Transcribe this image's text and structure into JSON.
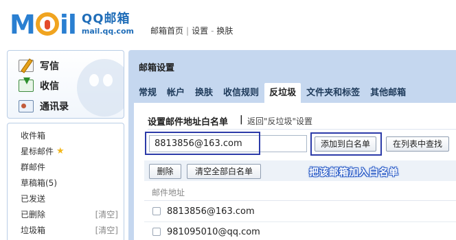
{
  "header": {
    "logo": {
      "letters": [
        "M",
        "il"
      ],
      "brand": "QQ邮箱",
      "url": "mail.qq.com"
    },
    "links": [
      "邮箱首页",
      "设置",
      "换肤"
    ],
    "link_separator": "|",
    "link_dash": "-"
  },
  "sidebar": {
    "actions": [
      {
        "label": "写信",
        "icon": "pencil-icon"
      },
      {
        "label": "收信",
        "icon": "inbox-download-icon"
      },
      {
        "label": "通讯录",
        "icon": "contacts-card-icon"
      }
    ],
    "folders": [
      {
        "label": "收件箱"
      },
      {
        "label": "星标邮件",
        "icon": "star-icon",
        "icon_glyph": "★"
      },
      {
        "label": "群邮件"
      },
      {
        "label": "草稿箱(5)"
      },
      {
        "label": "已发送"
      },
      {
        "label": "已删除",
        "action": "[清空]"
      },
      {
        "label": "垃圾箱",
        "action": "[清空]"
      }
    ]
  },
  "main": {
    "title": "邮箱设置",
    "tabs": [
      {
        "label": "常规",
        "active": false
      },
      {
        "label": "帐户",
        "active": false
      },
      {
        "label": "换肤",
        "active": false
      },
      {
        "label": "收信规则",
        "active": false
      },
      {
        "label": "反垃圾",
        "active": true
      },
      {
        "label": "文件夹和标签",
        "active": false
      },
      {
        "label": "其他邮箱",
        "active": false
      }
    ],
    "section": {
      "title": "设置邮件地址白名单",
      "divider": "|",
      "back_link": "返回\"反垃圾\"设置"
    },
    "input": {
      "value": "8813856@163.com",
      "placeholder": ""
    },
    "buttons": {
      "add": "添加到白名单",
      "find": "在列表中查找",
      "delete": "删除",
      "clear_all": "清空全部白名单"
    },
    "annotation": "把该邮箱加入白名单",
    "annotation_color": "#2e5fc8",
    "highlight_color": "#2b3aa8",
    "list": {
      "column_header": "邮件地址",
      "rows": [
        {
          "address": "8813856@163.com"
        },
        {
          "address": "981095010@qq.com"
        }
      ]
    }
  }
}
